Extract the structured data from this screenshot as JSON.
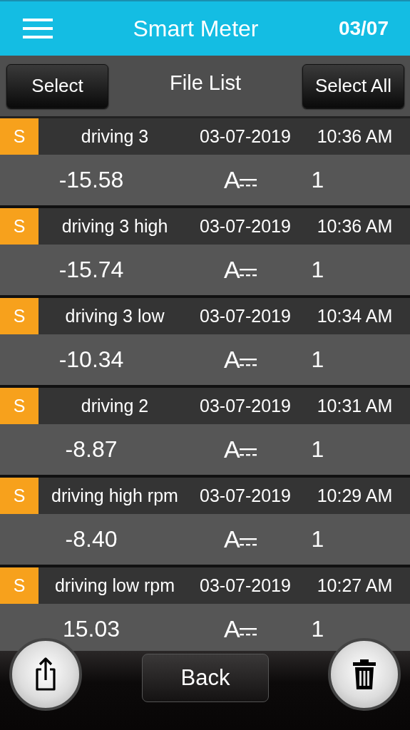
{
  "header": {
    "title": "Smart Meter",
    "date": "03/07"
  },
  "toolbar": {
    "left_button": "Select",
    "title": "File List",
    "right_button": "Select All"
  },
  "files": [
    {
      "badge": "S",
      "name": "driving 3",
      "date": "03-07-2019",
      "time": "10:36 AM",
      "value": "-15.58",
      "unit": "A",
      "count": "1"
    },
    {
      "badge": "S",
      "name": "driving 3 high",
      "date": "03-07-2019",
      "time": "10:36 AM",
      "value": "-15.74",
      "unit": "A",
      "count": "1"
    },
    {
      "badge": "S",
      "name": "driving 3 low",
      "date": "03-07-2019",
      "time": "10:34 AM",
      "value": "-10.34",
      "unit": "A",
      "count": "1"
    },
    {
      "badge": "S",
      "name": "driving 2",
      "date": "03-07-2019",
      "time": "10:31 AM",
      "value": "-8.87",
      "unit": "A",
      "count": "1"
    },
    {
      "badge": "S",
      "name": "driving high rpm",
      "date": "03-07-2019",
      "time": "10:29 AM",
      "value": "-8.40",
      "unit": "A",
      "count": "1"
    },
    {
      "badge": "S",
      "name": "driving low rpm",
      "date": "03-07-2019",
      "time": "10:27 AM",
      "value": "15.03",
      "unit": "A",
      "count": "1"
    }
  ],
  "footer": {
    "back_button": "Back"
  }
}
